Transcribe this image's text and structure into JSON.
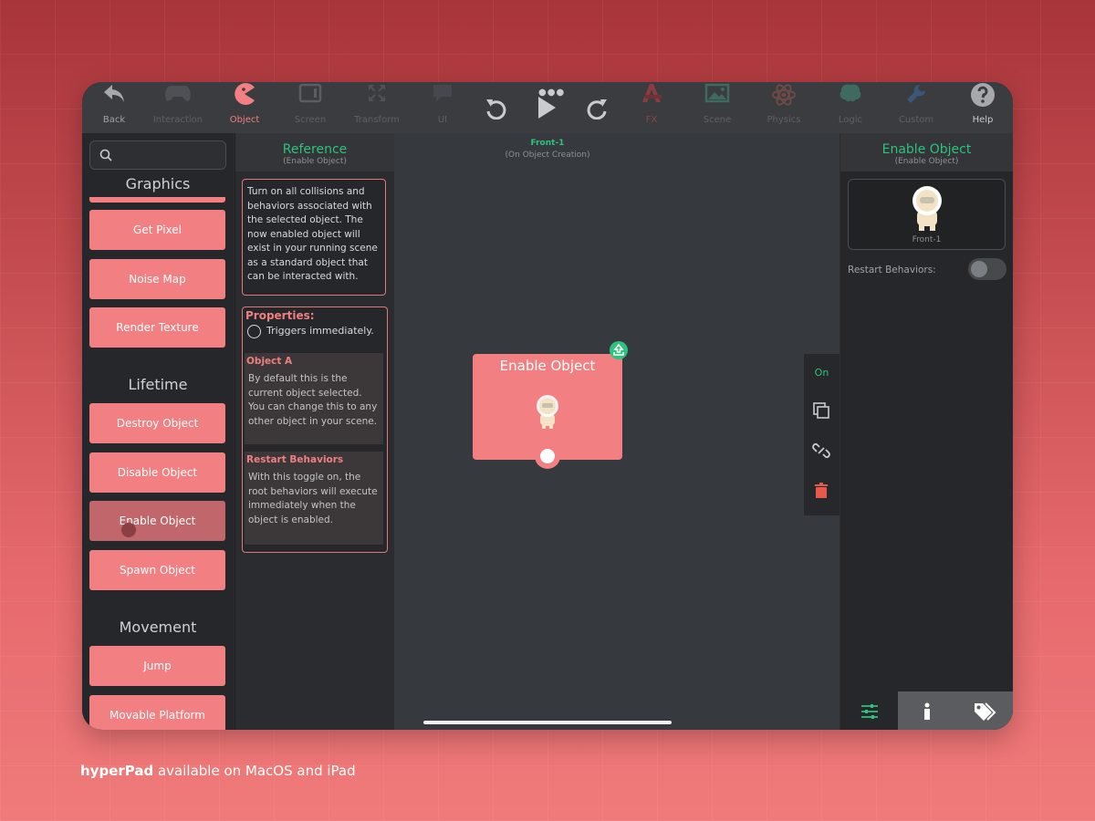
{
  "toolbar": {
    "items": [
      {
        "label": "Back",
        "icon": "back-arrow-icon"
      },
      {
        "label": "Interaction",
        "icon": "gamepad-icon"
      },
      {
        "label": "Object",
        "icon": "pacman-icon"
      },
      {
        "label": "Screen",
        "icon": "screen-icon"
      },
      {
        "label": "Transform",
        "icon": "transform-icon"
      },
      {
        "label": "UI",
        "icon": "speech-bubble-icon"
      },
      {
        "label": "FX",
        "icon": "fx-icon"
      },
      {
        "label": "Scene",
        "icon": "image-icon"
      },
      {
        "label": "Physics",
        "icon": "atom-icon"
      },
      {
        "label": "Logic",
        "icon": "brain-icon"
      },
      {
        "label": "Custom",
        "icon": "wrench-icon"
      },
      {
        "label": "Help",
        "icon": "question-icon"
      }
    ],
    "active": "Object",
    "controls": [
      "undo-icon",
      "play-icon",
      "redo-icon"
    ]
  },
  "library": {
    "search": {
      "placeholder": "",
      "value": ""
    },
    "sections": [
      {
        "title": "Graphics",
        "items": [
          "Get Pixel",
          "Noise Map",
          "Render Texture"
        ]
      },
      {
        "title": "Lifetime",
        "items": [
          "Destroy Object",
          "Disable Object",
          "Enable Object",
          "Spawn Object"
        ]
      },
      {
        "title": "Movement",
        "items": [
          "Jump",
          "Movable Platform"
        ]
      }
    ],
    "selected": "Enable Object"
  },
  "reference": {
    "title": "Reference",
    "subtitle": "(Enable Object)",
    "description": "Turn on all collisions and behaviors associated with the selected object. The now enabled object will exist in your running scene as a standard object that can be interacted with.",
    "properties_title": "Properties:",
    "trigger_text": "Triggers immediately.",
    "props": [
      {
        "name": "Object A",
        "text": "By default this is the current object selected. You can change this to any other object in your scene."
      },
      {
        "name": "Restart Behaviors",
        "text": "With this toggle on, the root behaviors will execute immediately when the object is enabled."
      }
    ]
  },
  "canvas": {
    "object_name": "Front-1",
    "event": "(On Object Creation)",
    "node_title": "Enable Object",
    "tools": {
      "on_label": "On",
      "icons": [
        "copy-icon",
        "unlink-icon",
        "trash-icon"
      ]
    }
  },
  "inspector": {
    "title": "Enable Object",
    "subtitle": "(Enable Object)",
    "object_name": "Front-1",
    "restart_label": "Restart Behaviors:",
    "restart_value": false,
    "tabs": [
      "sliders-icon",
      "info-icon",
      "tags-icon"
    ]
  },
  "footer": {
    "brand": "hyperPad",
    "tagline": " available on MacOS and iPad"
  },
  "colors": {
    "accent": "#f27f81",
    "green": "#2ec27e",
    "panel": "#25272a"
  }
}
